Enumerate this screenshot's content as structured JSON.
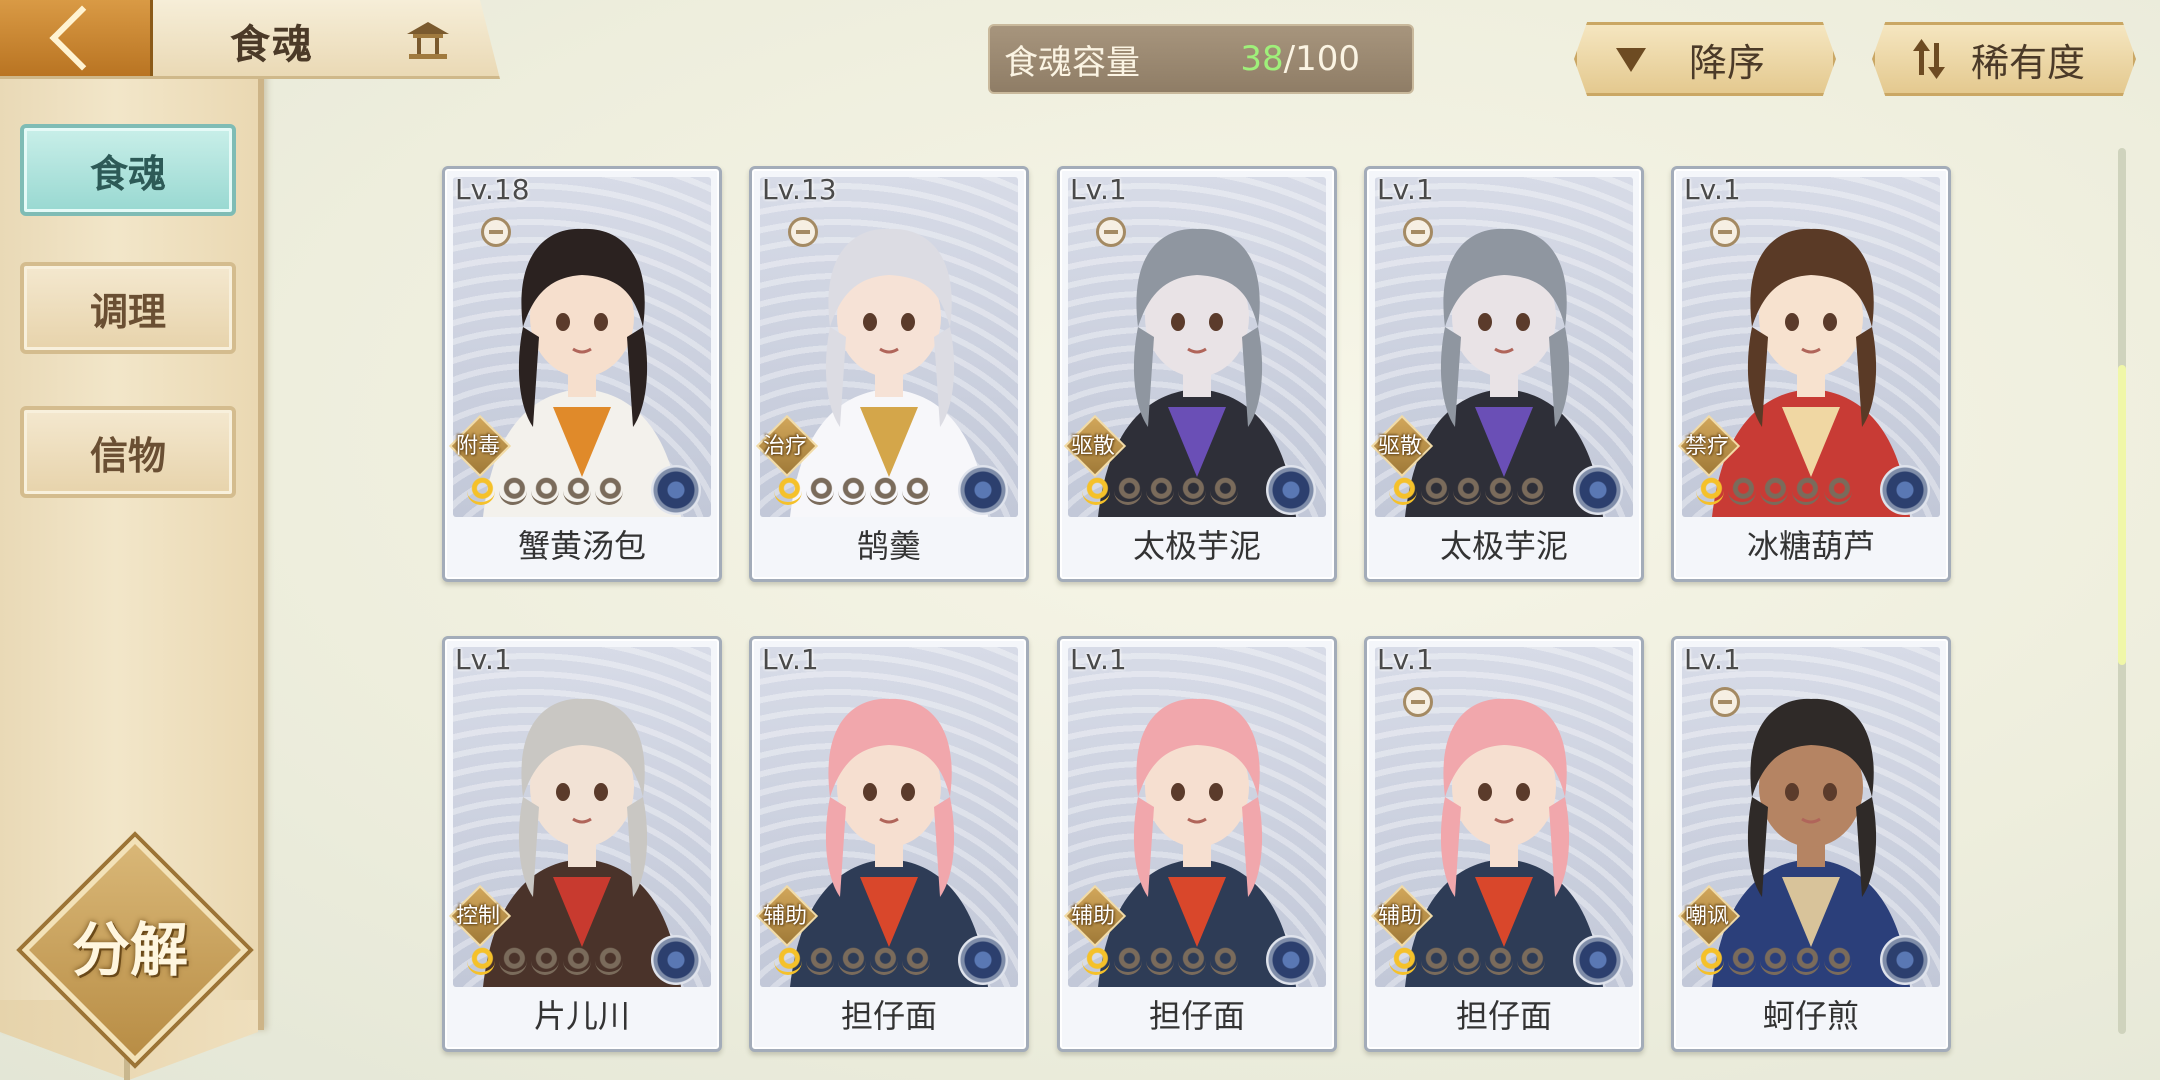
{
  "header": {
    "title": "食魂"
  },
  "sidebar": {
    "tabs": [
      {
        "label": "食魂",
        "active": true
      },
      {
        "label": "调理",
        "active": false
      },
      {
        "label": "信物",
        "active": false
      }
    ],
    "decompose_label": "分解"
  },
  "capacity": {
    "label": "食魂容量",
    "current": "38",
    "max": "/100"
  },
  "sort": {
    "order_label": "降序",
    "rarity_label": "稀有度"
  },
  "cards": [
    {
      "level": "Lv.18",
      "name": "蟹黄汤包",
      "role": "附毒",
      "stars": 1,
      "bowl": true,
      "palette": {
        "hair": "#2b2220",
        "cloth": "#f3f1ec",
        "accent": "#e08a2a",
        "skin": "#f6dfcd"
      }
    },
    {
      "level": "Lv.13",
      "name": "鹄羹",
      "role": "治疗",
      "stars": 1,
      "bowl": true,
      "palette": {
        "hair": "#dcdce3",
        "cloth": "#f7f7fa",
        "accent": "#d4a64a",
        "skin": "#f6e2d6"
      }
    },
    {
      "level": "Lv.1",
      "name": "太极芋泥",
      "role": "驱散",
      "stars": 1,
      "bowl": true,
      "palette": {
        "hair": "#8f96a0",
        "cloth": "#2e2f38",
        "accent": "#6a4fb6",
        "skin": "#e9e3e6"
      }
    },
    {
      "level": "Lv.1",
      "name": "太极芋泥",
      "role": "驱散",
      "stars": 1,
      "bowl": true,
      "palette": {
        "hair": "#8f96a0",
        "cloth": "#2e2f38",
        "accent": "#6a4fb6",
        "skin": "#e9e3e6"
      }
    },
    {
      "level": "Lv.1",
      "name": "冰糖葫芦",
      "role": "禁疗",
      "stars": 1,
      "bowl": true,
      "palette": {
        "hair": "#5a3a26",
        "cloth": "#c83b35",
        "accent": "#f0d7a3",
        "skin": "#f7e2cf"
      }
    },
    {
      "level": "Lv.1",
      "name": "片儿川",
      "role": "控制",
      "stars": 1,
      "bowl": false,
      "palette": {
        "hair": "#c9c7c3",
        "cloth": "#4a332a",
        "accent": "#c83a2f",
        "skin": "#f2e2d5"
      }
    },
    {
      "level": "Lv.1",
      "name": "担仔面",
      "role": "辅助",
      "stars": 1,
      "bowl": false,
      "palette": {
        "hair": "#f1a7ac",
        "cloth": "#2e3c56",
        "accent": "#d9472b",
        "skin": "#f6dfd0"
      }
    },
    {
      "level": "Lv.1",
      "name": "担仔面",
      "role": "辅助",
      "stars": 1,
      "bowl": false,
      "palette": {
        "hair": "#f1a7ac",
        "cloth": "#2e3c56",
        "accent": "#d9472b",
        "skin": "#f6dfd0"
      }
    },
    {
      "level": "Lv.1",
      "name": "担仔面",
      "role": "辅助",
      "stars": 1,
      "bowl": true,
      "palette": {
        "hair": "#f1a7ac",
        "cloth": "#2e3c56",
        "accent": "#d9472b",
        "skin": "#f6dfd0"
      }
    },
    {
      "level": "Lv.1",
      "name": "蚵仔煎",
      "role": "嘲讽",
      "stars": 1,
      "bowl": true,
      "palette": {
        "hair": "#2f2a28",
        "cloth": "#2b3f7a",
        "accent": "#d8c39a",
        "skin": "#b58463"
      }
    }
  ]
}
